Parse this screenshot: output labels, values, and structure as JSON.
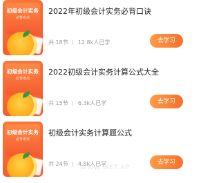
{
  "courses": [
    {
      "cover_title": "初级会计实务",
      "cover_sub": "必背考点",
      "title": "2022年初级会计实务必背口诀",
      "sections": "18节",
      "learners": "12.8k人已学",
      "cta": "去学习"
    },
    {
      "cover_title": "初级会计实务",
      "cover_sub": "必背考点",
      "title": "2022初级会计实务计算公式大全",
      "sections": "15节",
      "learners": "6.3k人已学",
      "cta": "去学习"
    },
    {
      "cover_title": "初级会计实务",
      "cover_sub": "必背考点",
      "title": "初级会计实务计算题公式",
      "sections": "24节",
      "learners": "4.8k人已学",
      "cta": "去学习"
    }
  ],
  "meta_prefix": "共",
  "watermark": "WWW.WET.AP",
  "colors": {
    "accent": "#f5712c",
    "cover": "#f5562d"
  }
}
